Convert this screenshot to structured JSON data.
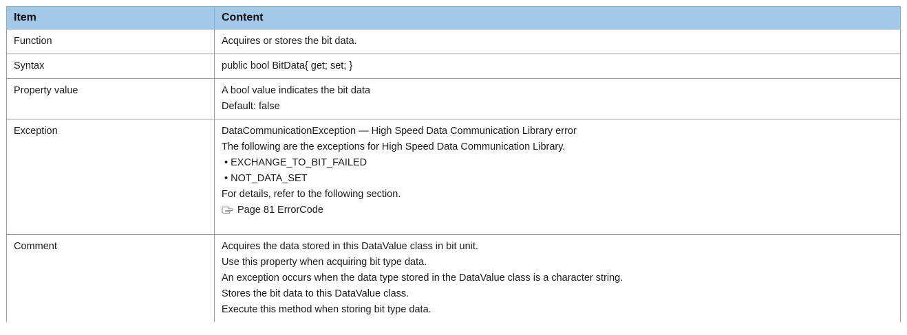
{
  "table": {
    "headers": {
      "item": "Item",
      "content": "Content"
    },
    "rows": {
      "function": {
        "item": "Function",
        "lines": [
          "Acquires or stores the bit data."
        ]
      },
      "syntax": {
        "item": "Syntax",
        "lines": [
          "public bool BitData{ get; set; }"
        ]
      },
      "property_value": {
        "item": "Property value",
        "lines": [
          "A bool value indicates the bit data",
          "Default: false"
        ]
      },
      "exception": {
        "item": "Exception",
        "lines": [
          "DataCommunicationException ― High Speed Data Communication Library error",
          "The following are the exceptions for High Speed Data Communication Library."
        ],
        "bullets": [
          "EXCHANGE_TO_BIT_FAILED",
          "NOT_DATA_SET"
        ],
        "bullet_symbol": "•",
        "details_note": "For details, refer to the following section.",
        "reference": {
          "icon": "pointing-hand-reference-icon",
          "text": "Page 81 ErrorCode"
        }
      },
      "comment": {
        "item": "Comment",
        "lines": [
          "Acquires the data stored in this DataValue class in bit unit.",
          "Use this property when acquiring bit type data.",
          "An exception occurs when the data type stored in the DataValue class is a character string.",
          "Stores the bit data to this DataValue class.",
          "Execute this method when storing bit type data."
        ]
      }
    }
  },
  "colors": {
    "header_background": "#a4c9e8",
    "border": "#9a9a9a"
  }
}
